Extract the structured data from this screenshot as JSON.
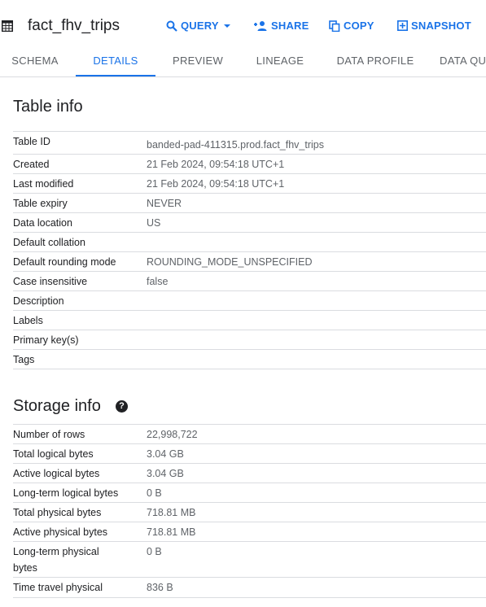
{
  "header": {
    "title": "fact_fhv_trips",
    "actions": {
      "query": "QUERY",
      "share": "SHARE",
      "copy": "COPY",
      "snapshot": "SNAPSHOT"
    }
  },
  "tabs": [
    "SCHEMA",
    "DETAILS",
    "PREVIEW",
    "LINEAGE",
    "DATA PROFILE",
    "DATA QU"
  ],
  "active_tab": "DETAILS",
  "table_info": {
    "title": "Table info",
    "rows": [
      {
        "label": "Table ID",
        "value": "banded-pad-411315.prod.fact_fhv_trips"
      },
      {
        "label": "Created",
        "value": "21 Feb 2024, 09:54:18 UTC+1"
      },
      {
        "label": "Last modified",
        "value": "21 Feb 2024, 09:54:18 UTC+1"
      },
      {
        "label": "Table expiry",
        "value": "NEVER"
      },
      {
        "label": "Data location",
        "value": "US"
      },
      {
        "label": "Default collation",
        "value": ""
      },
      {
        "label": "Default rounding mode",
        "value": "ROUNDING_MODE_UNSPECIFIED"
      },
      {
        "label": "Case insensitive",
        "value": "false"
      },
      {
        "label": "Description",
        "value": ""
      },
      {
        "label": "Labels",
        "value": ""
      },
      {
        "label": "Primary key(s)",
        "value": ""
      },
      {
        "label": "Tags",
        "value": ""
      }
    ]
  },
  "storage_info": {
    "title": "Storage info",
    "rows": [
      {
        "label": "Number of rows",
        "value": "22,998,722"
      },
      {
        "label": "Total logical bytes",
        "value": "3.04 GB"
      },
      {
        "label": "Active logical bytes",
        "value": "3.04 GB"
      },
      {
        "label": "Long-term logical bytes",
        "value": "0 B"
      },
      {
        "label": "Total physical bytes",
        "value": "718.81 MB"
      },
      {
        "label": "Active physical bytes",
        "value": "718.81 MB"
      },
      {
        "label": "Long-term physical",
        "label_line2": "bytes",
        "value": "0 B"
      },
      {
        "label": "Time travel physical",
        "value": "836 B"
      }
    ]
  },
  "colors": {
    "accent": "#1a73e8",
    "text": "#202124",
    "muted": "#5f6368",
    "divider": "#dadce0"
  }
}
